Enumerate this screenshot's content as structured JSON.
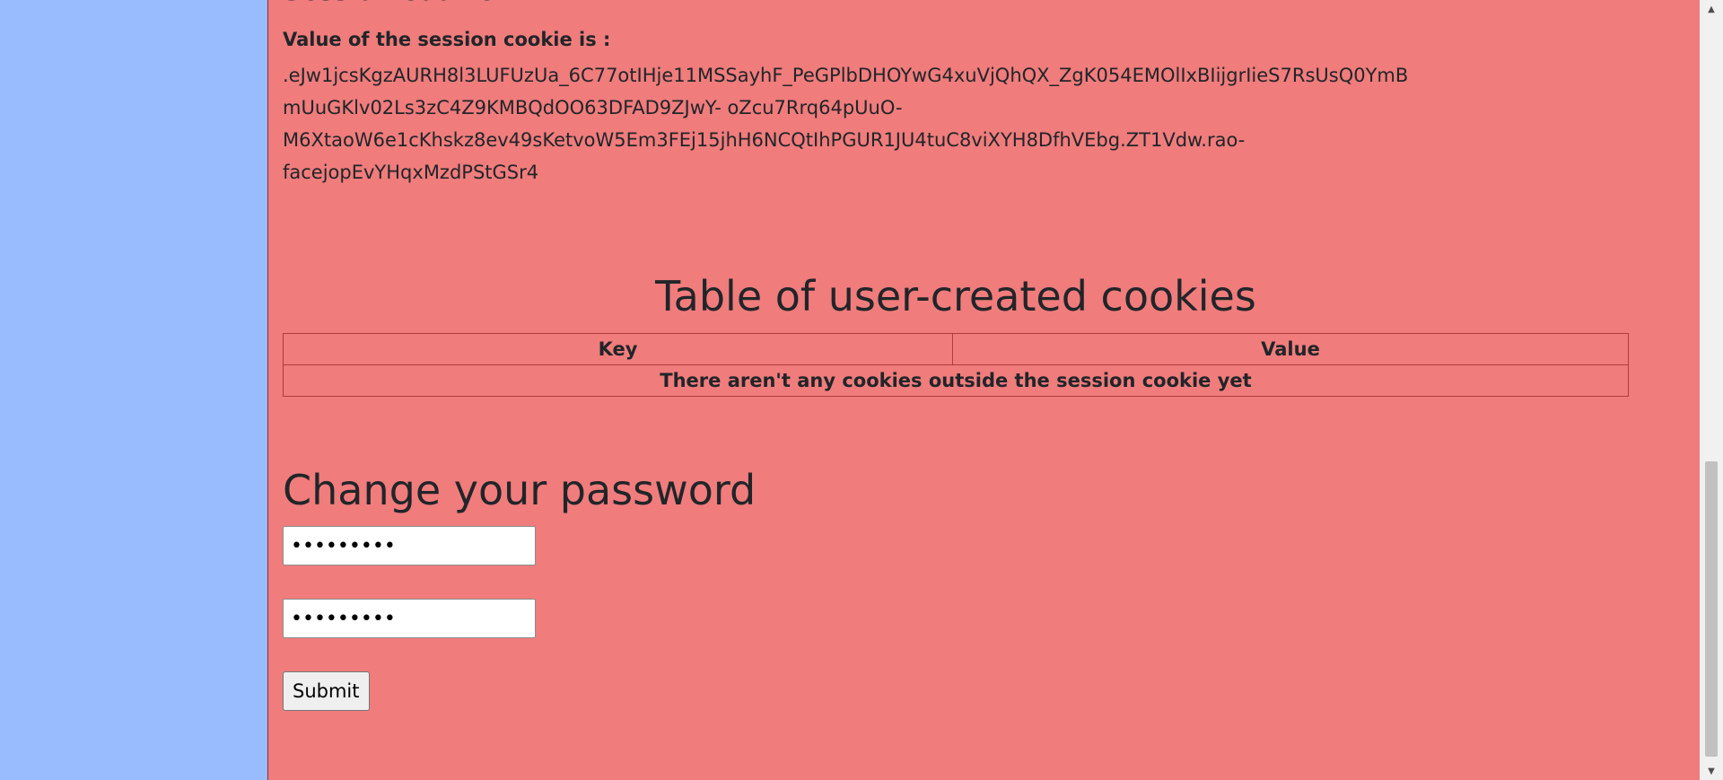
{
  "session": {
    "heading": "Session cookie",
    "label": "Value of the session cookie is :",
    "value_lines": [
      ".eJw1jcsKgzAURH8l3LUFUzUa_6C77otIHje11MSSayhF_PeGPlbDHOYwG4xuVjQhQX_ZgK054EMOlIxBIijgrIieS7RsUsQ0YmB",
      "mUuGKlv02Ls3zC4Z9KMBQdOO63DFAD9ZJwY- oZcu7Rrq64pUuO-",
      "M6XtaoW6e1cKhskz8ev49sKetvoW5Em3FEj15jhH6NCQtIhPGUR1JU4tuC8viXYH8DfhVEbg.ZT1Vdw.rao-",
      "facejopEvYHqxMzdPStGSr4"
    ]
  },
  "cookies_table": {
    "title": "Table of user-created cookies",
    "headers": [
      "Key",
      "Value"
    ],
    "empty_message": "There aren't any cookies outside the session cookie yet"
  },
  "password_form": {
    "title": "Change your password",
    "password1_value": "•••••••••",
    "password2_value": "•••••••••",
    "submit_label": "Submit"
  },
  "scrollbar": {
    "up_arrow": "▲",
    "down_arrow": "▼",
    "position_fraction": 0.76
  },
  "colors": {
    "sidebar": "#99bbff",
    "main_background": "#f07c7c",
    "table_border": "#b23a3a"
  }
}
